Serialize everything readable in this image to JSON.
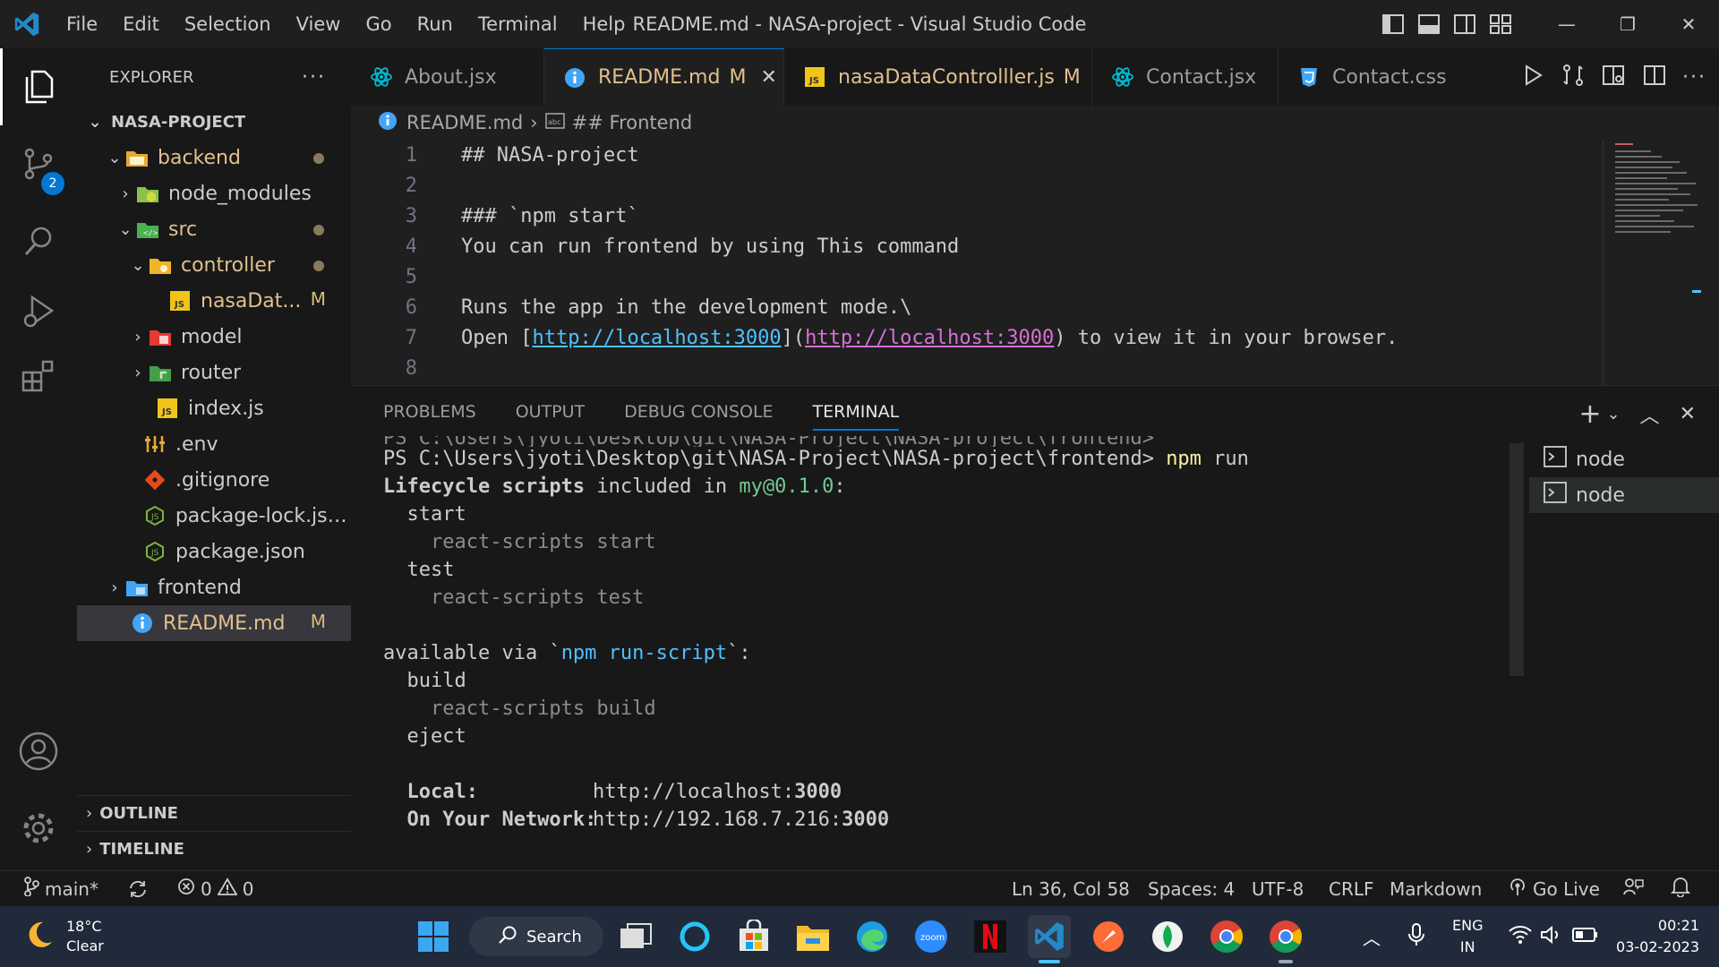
{
  "window": {
    "title": "README.md - NASA-project - Visual Studio Code",
    "menu": [
      "File",
      "Edit",
      "Selection",
      "View",
      "Go",
      "Run",
      "Terminal",
      "Help"
    ]
  },
  "activity": {
    "scm_badge": "2"
  },
  "explorer": {
    "header": "EXPLORER",
    "root": "NASA-PROJECT",
    "items": [
      {
        "label": "backend",
        "git": "dot"
      },
      {
        "label": "node_modules"
      },
      {
        "label": "src",
        "git": "dot"
      },
      {
        "label": "controller",
        "git": "dot"
      },
      {
        "label": "nasaDat...",
        "git": "M"
      },
      {
        "label": "model"
      },
      {
        "label": "router"
      },
      {
        "label": "index.js"
      },
      {
        "label": ".env"
      },
      {
        "label": ".gitignore"
      },
      {
        "label": "package-lock.json"
      },
      {
        "label": "package.json"
      },
      {
        "label": "frontend"
      },
      {
        "label": "README.md",
        "git": "M"
      }
    ],
    "outline": "OUTLINE",
    "timeline": "TIMELINE"
  },
  "tabs": [
    {
      "label": "About.jsx",
      "modified": ""
    },
    {
      "label": "README.md",
      "modified": "M"
    },
    {
      "label": "nasaDataControlller.js",
      "modified": "M"
    },
    {
      "label": "Contact.jsx",
      "modified": ""
    },
    {
      "label": "Contact.css",
      "modified": ""
    }
  ],
  "breadcrumb": {
    "file": "README.md",
    "symbol": "## Frontend"
  },
  "editor": {
    "lines": [
      {
        "n": "1",
        "heading": "## NASA-project"
      },
      {
        "n": "2"
      },
      {
        "n": "3",
        "heading": "### `npm start`"
      },
      {
        "n": "4",
        "text": "You can run frontend by using This command"
      },
      {
        "n": "5"
      },
      {
        "n": "6",
        "text": "Runs the app in the development mode.\\"
      },
      {
        "n": "7",
        "pre": "Open [",
        "link": "http://localhost:3000",
        "mid": "](",
        "url": "http://localhost:3000",
        "post": ") to view it in your browser."
      },
      {
        "n": "8"
      }
    ]
  },
  "panel": {
    "tabs": [
      "PROBLEMS",
      "OUTPUT",
      "DEBUG CONSOLE",
      "TERMINAL"
    ],
    "terminal": {
      "prompt": "PS C:\\Users\\jyoti\\Desktop\\git\\NASA-Project\\NASA-project\\frontend>",
      "command": "npm",
      "command_arg": " run",
      "lifecycle_pre": "Lifecycle scripts",
      "lifecycle_mid": " included in ",
      "pkg": "my@0.1.0",
      "lifecycle_post": ":",
      "start": "  start",
      "start_cmd": "    react-scripts start",
      "test": "  test",
      "test_cmd": "    react-scripts test",
      "avail_pre": "available via `",
      "avail_cmd": "npm run-script",
      "avail_post": "`:",
      "build": "  build",
      "build_cmd": "    react-scripts build",
      "eject": "  eject",
      "local_label": "  Local:",
      "local_url": "http://localhost:",
      "local_port": "3000",
      "network_label": "  On Your Network:",
      "network_url": "http://192.168.7.216:",
      "network_port": "3000"
    },
    "terminals": [
      "node",
      "node"
    ]
  },
  "status": {
    "branch": "main*",
    "errors": "0",
    "warnings": "0",
    "position": "Ln 36, Col 58",
    "spaces": "Spaces: 4",
    "encoding": "UTF-8",
    "eol": "CRLF",
    "language": "Markdown",
    "golive": "Go Live"
  },
  "taskbar": {
    "weather_temp": "18°C",
    "weather_desc": "Clear",
    "search": "Search",
    "zoom": "zoom",
    "lang": "ENG",
    "region": "IN",
    "time": "00:21",
    "date": "03-02-2023"
  },
  "colors": {
    "accent": "#0078d4",
    "modified": "#e2c08d",
    "heading": "#f47067"
  }
}
